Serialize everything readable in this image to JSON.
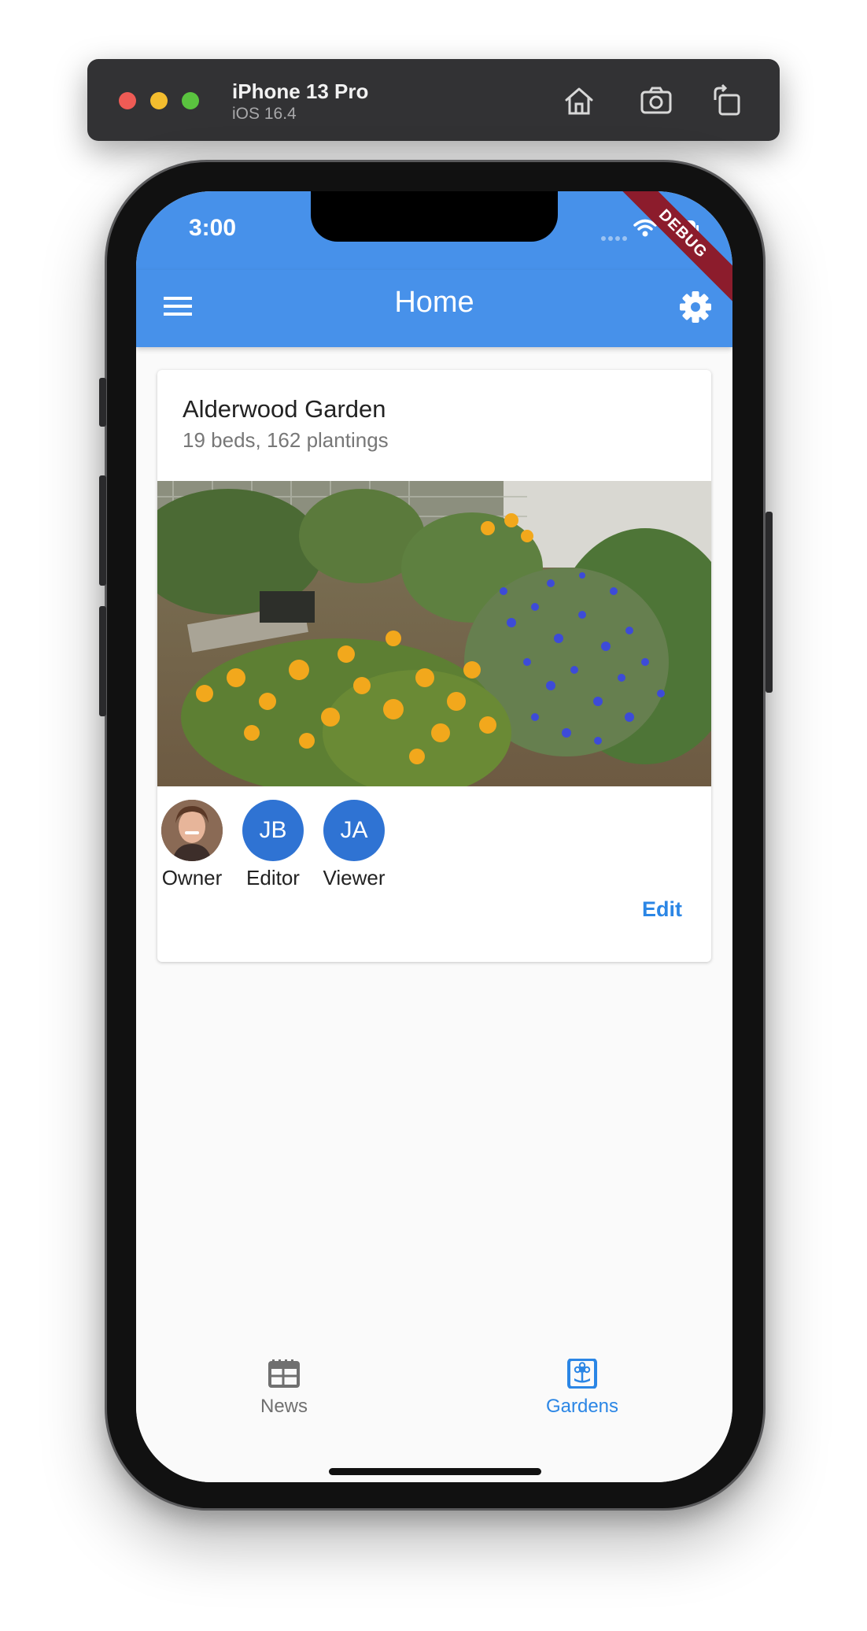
{
  "simulator": {
    "device_name": "iPhone 13 Pro",
    "os_version": "iOS 16.4",
    "toolbar_icons": [
      "home-icon",
      "screenshot-icon",
      "rotate-icon"
    ]
  },
  "status_bar": {
    "time": "3:00",
    "debug_banner": "DEBUG"
  },
  "app_bar": {
    "title": "Home",
    "menu_icon": "hamburger-menu-icon",
    "settings_icon": "gear-icon"
  },
  "garden_card": {
    "name": "Alderwood Garden",
    "summary": "19 beds, 162 plantings",
    "members": [
      {
        "initials": "",
        "role": "Owner",
        "has_photo": true
      },
      {
        "initials": "JB",
        "role": "Editor",
        "has_photo": false
      },
      {
        "initials": "JA",
        "role": "Viewer",
        "has_photo": false
      }
    ],
    "edit_label": "Edit"
  },
  "bottom_nav": {
    "items": [
      {
        "label": "News",
        "icon": "newspaper-icon",
        "active": false
      },
      {
        "label": "Gardens",
        "icon": "garden-icon",
        "active": true
      }
    ]
  },
  "colors": {
    "primary": "#4791ea",
    "avatar": "#2f73d3",
    "active_nav": "#2b86e5",
    "inactive_nav": "#707070"
  }
}
